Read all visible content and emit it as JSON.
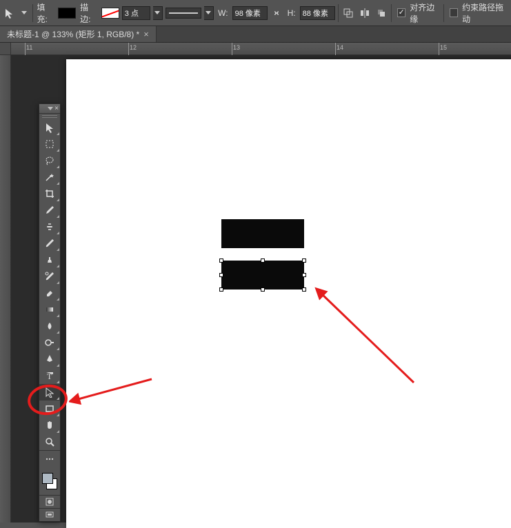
{
  "options": {
    "fill_label": "填充:",
    "stroke_label": "描边:",
    "stroke_width": "3 点",
    "w_label": "W:",
    "w_value": "98 像素",
    "h_label": "H:",
    "h_value": "88 像素",
    "align_edges_label": "对齐边缘",
    "constrain_label": "约束路径拖动"
  },
  "tab": {
    "title": "未标题-1 @ 133% (矩形 1, RGB/8) *"
  },
  "ruler": {
    "marks": [
      "11",
      "12",
      "13",
      "14",
      "15"
    ]
  }
}
